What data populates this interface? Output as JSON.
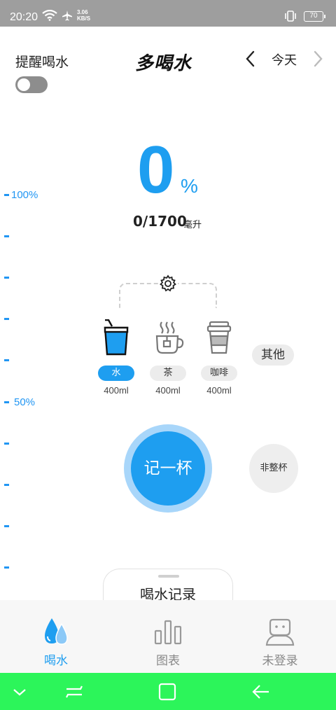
{
  "status_bar": {
    "time": "20:20",
    "net_speed_value": "3.06",
    "net_speed_unit": "KB/S",
    "battery": "70"
  },
  "header": {
    "reminder_label": "提醒喝水",
    "reminder_on": false,
    "title": "多喝水",
    "date_label": "今天"
  },
  "progress": {
    "percent": "0",
    "percent_sign": "%",
    "amount": "0/1700",
    "unit": "毫升",
    "scale_top_label": "100%",
    "scale_mid_label": "50%"
  },
  "drinks": [
    {
      "label": "水",
      "volume": "400ml",
      "icon": "water-glass-icon",
      "active": true
    },
    {
      "label": "茶",
      "volume": "400ml",
      "icon": "tea-cup-icon",
      "active": false
    },
    {
      "label": "咖啡",
      "volume": "400ml",
      "icon": "coffee-cup-icon",
      "active": false
    }
  ],
  "other_label": "其他",
  "record_button": "记一杯",
  "partial_button": "非整杯",
  "drawer_title": "喝水记录",
  "bottom_nav": [
    {
      "label": "喝水",
      "icon": "water-drops-icon",
      "active": true
    },
    {
      "label": "图表",
      "icon": "bar-chart-icon",
      "active": false
    },
    {
      "label": "未登录",
      "icon": "user-icon",
      "active": false
    }
  ],
  "colors": {
    "accent": "#1e9ef0",
    "accent_light": "#a8d6fa",
    "system_nav": "#2cf55a"
  }
}
